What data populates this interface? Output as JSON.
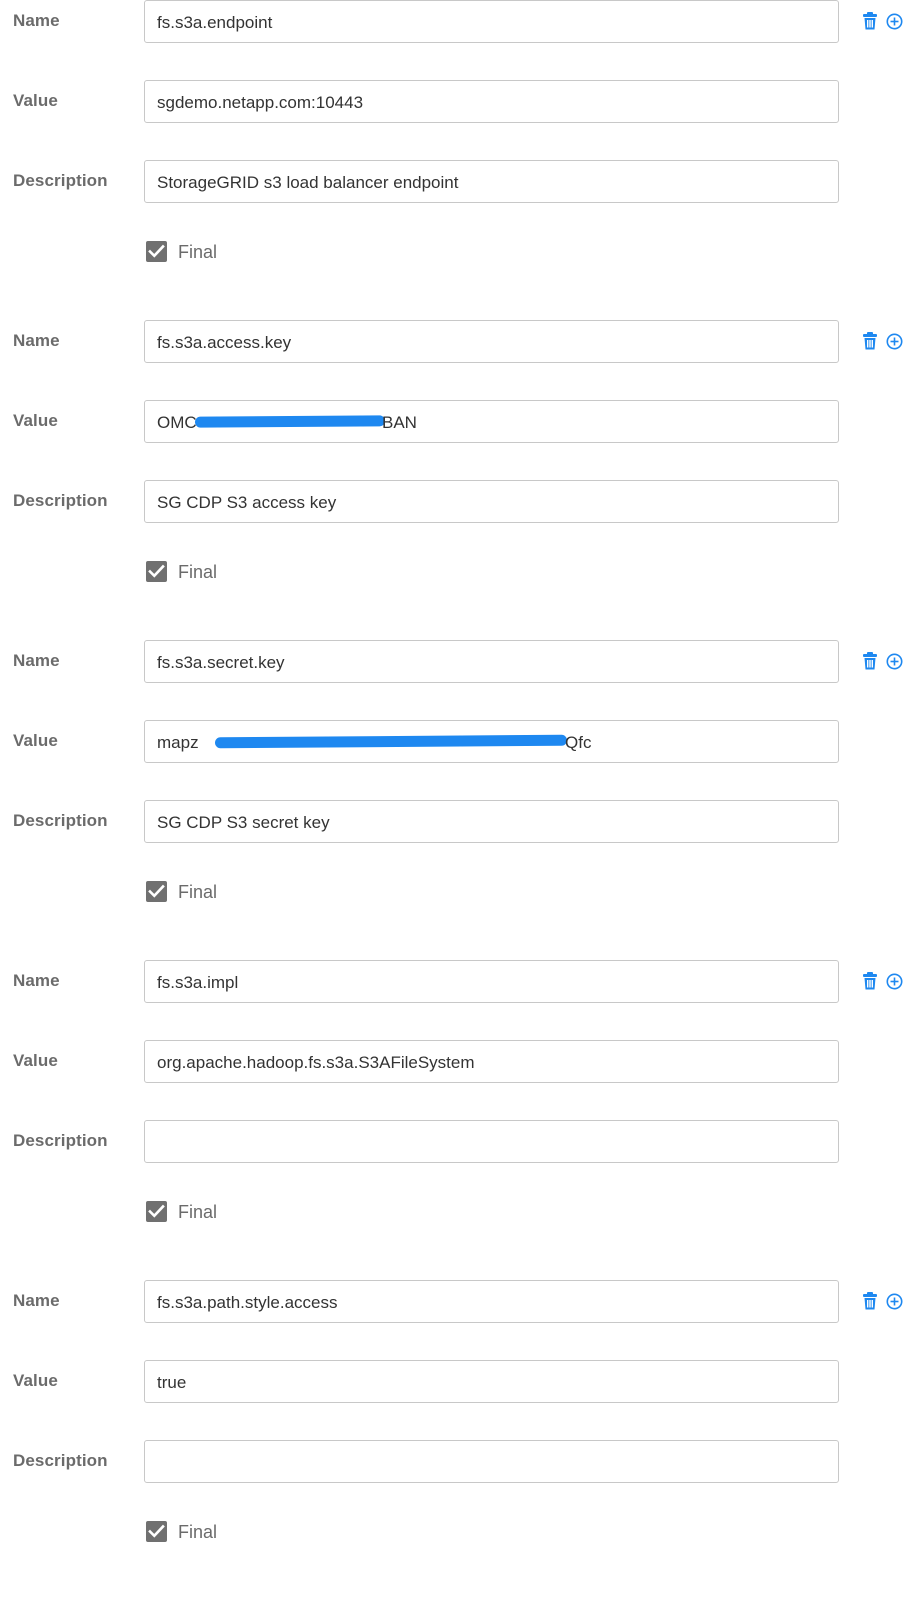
{
  "labels": {
    "name": "Name",
    "value": "Value",
    "description": "Description",
    "final": "Final"
  },
  "icons": {
    "delete": "trash-icon",
    "add": "plus-circle-icon"
  },
  "colors": {
    "accent": "#1e88f0",
    "checkbox": "#707070",
    "label": "#6b6b6b"
  },
  "properties": [
    {
      "name": "fs.s3a.endpoint",
      "value": "sgdemo.netapp.com:10443",
      "description": "StorageGRID s3 load balancer endpoint",
      "final": true
    },
    {
      "name": "fs.s3a.access.key",
      "value": "OMC",
      "value_tail": "BAN",
      "value_redacted": true,
      "description": "SG CDP S3 access key",
      "final": true
    },
    {
      "name": "fs.s3a.secret.key",
      "value": "mapz",
      "value_tail": "Qfc",
      "value_redacted": true,
      "description": "SG CDP S3 secret key",
      "final": true
    },
    {
      "name": "fs.s3a.impl",
      "value": "org.apache.hadoop.fs.s3a.S3AFileSystem",
      "description": "",
      "final": true
    },
    {
      "name": "fs.s3a.path.style.access",
      "value": "true",
      "description": "",
      "final": true
    }
  ]
}
